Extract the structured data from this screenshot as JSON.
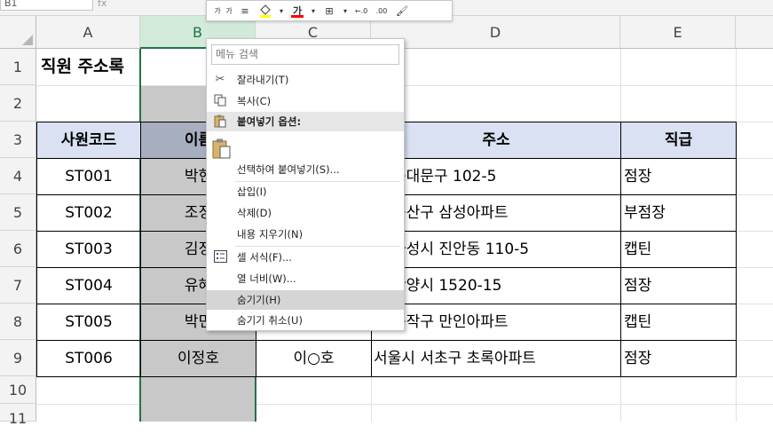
{
  "formula_bar": {
    "name_box": "B1",
    "fx_label": "fx"
  },
  "mini_toolbar": {
    "increase_font": "가",
    "decrease_font": "가",
    "align": "≡",
    "fill_color": "#ffff00",
    "font_color_label": "가",
    "font_color": "#ff0000",
    "borders": "⊞",
    "dec_increase": "←.0",
    "dec_decrease": ".00",
    "format_painter": "🖌"
  },
  "columns": [
    "A",
    "B",
    "C",
    "D",
    "E"
  ],
  "rows": [
    "1",
    "2",
    "3",
    "4",
    "5",
    "6",
    "7",
    "8",
    "9",
    "10",
    "11"
  ],
  "sheet": {
    "title": "직원 주소록",
    "headers": {
      "code": "사원코드",
      "name": "이름",
      "address": "주소",
      "position": "직급"
    },
    "employees": [
      {
        "code": "ST001",
        "name": "박현",
        "address": "시 동대문구 102-5",
        "position": "점장"
      },
      {
        "code": "ST002",
        "name": "조정",
        "address": "시 용산구 삼성아파트",
        "position": "부점장"
      },
      {
        "code": "ST003",
        "name": "김정",
        "address": "도 화성시 진안동 110-5",
        "position": "캡틴"
      },
      {
        "code": "ST004",
        "name": "유혜",
        "address": "도 안양시 1520-15",
        "position": "점장"
      },
      {
        "code": "ST005",
        "name": "박민",
        "address": "시 동작구 만인아파트",
        "position": "캡틴"
      },
      {
        "code": "ST006",
        "name": "이정호",
        "name_masked": "이○호",
        "address": "서울시 서초구 초록아파트",
        "position": "점장"
      }
    ]
  },
  "context_menu": {
    "search_placeholder": "메뉴 검색",
    "items": [
      {
        "label": "잘라내기(T)",
        "icon": "scissors-icon"
      },
      {
        "label": "복사(C)",
        "icon": "copy-icon"
      },
      {
        "label": "붙여넣기 옵션:",
        "icon": "paste-icon"
      },
      {
        "label": "",
        "icon": "paste-option-icon"
      },
      {
        "label": "선택하여 붙여넣기(S)...",
        "icon": ""
      },
      {
        "label": "삽입(I)",
        "icon": ""
      },
      {
        "label": "삭제(D)",
        "icon": ""
      },
      {
        "label": "내용 지우기(N)",
        "icon": ""
      },
      {
        "label": "셀 서식(F)...",
        "icon": "format-cells-icon"
      },
      {
        "label": "열 너비(W)...",
        "icon": ""
      },
      {
        "label": "숨기기(H)",
        "icon": ""
      },
      {
        "label": "숨기기 취소(U)",
        "icon": ""
      }
    ]
  },
  "colors": {
    "header_fill": "#d9e1f2",
    "selection": "#c8c8c8",
    "selection_border": "#217346"
  }
}
